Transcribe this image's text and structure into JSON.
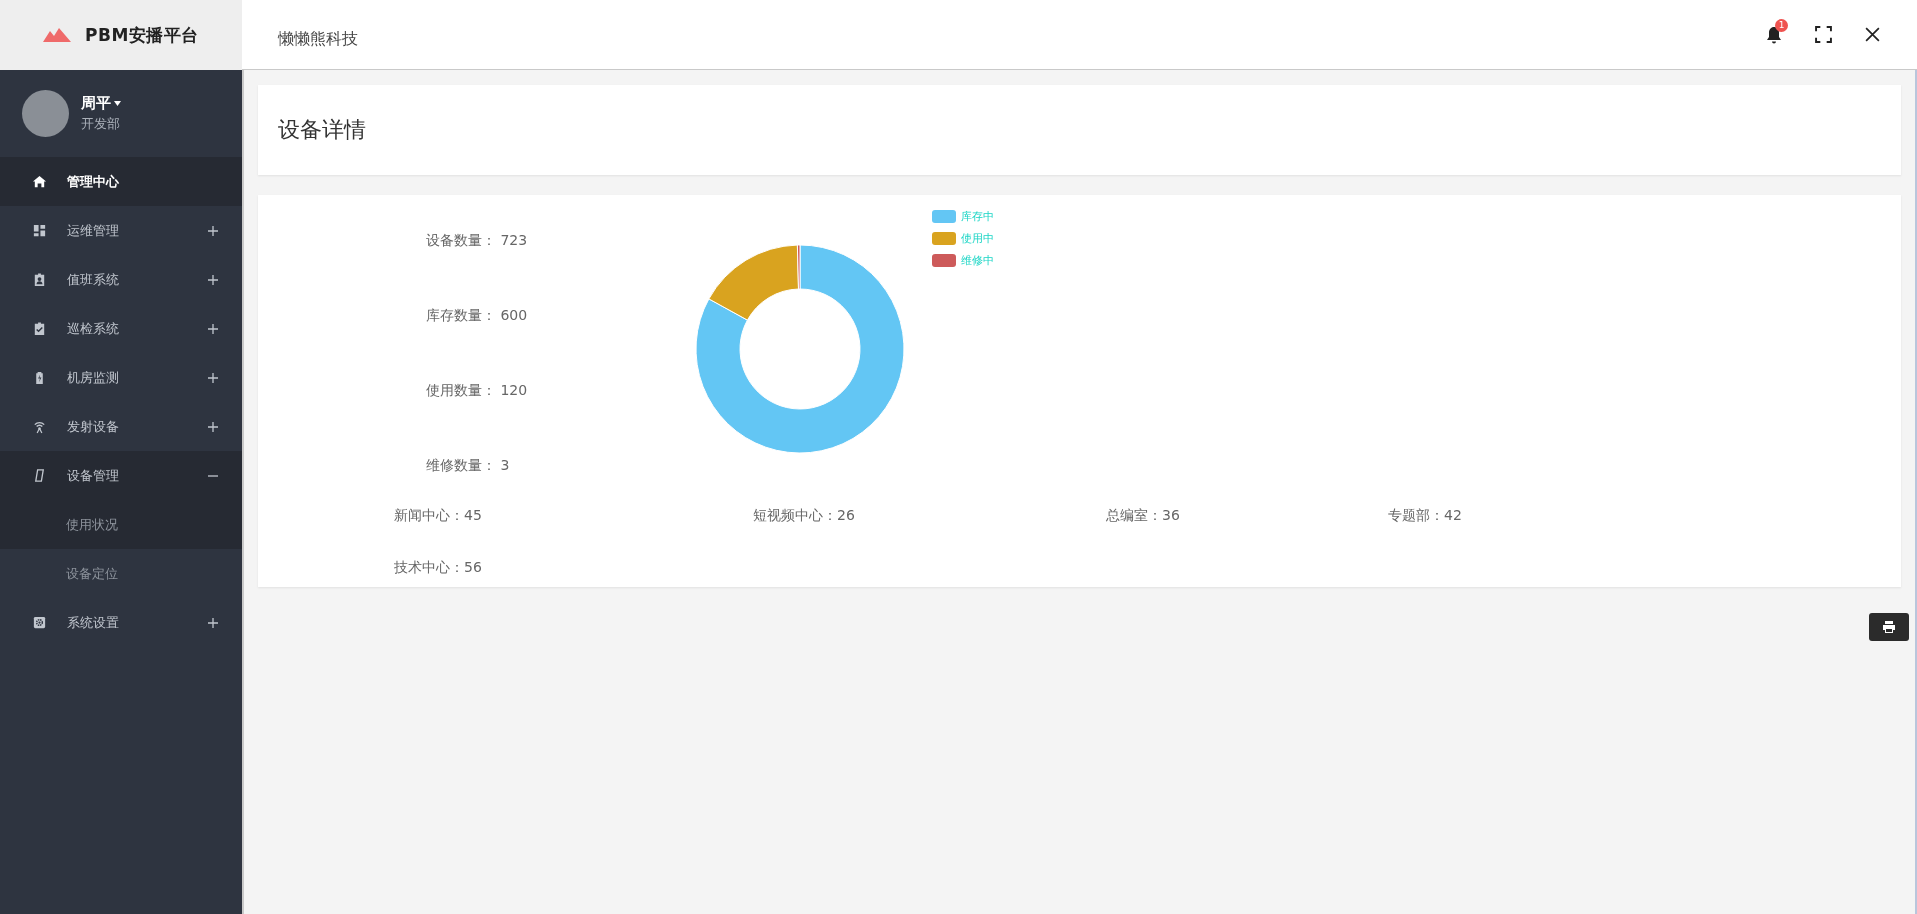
{
  "brand": {
    "name": "PBM安播平台"
  },
  "header": {
    "title": "懒懒熊科技",
    "notification_count": "1"
  },
  "user": {
    "name": "周平",
    "department": "开发部"
  },
  "sidebar": {
    "items": [
      {
        "label": "管理中心",
        "selected": true
      },
      {
        "label": "运维管理",
        "selected": false,
        "expanded": false
      },
      {
        "label": "值班系统",
        "selected": false,
        "expanded": false
      },
      {
        "label": "巡检系统",
        "selected": false,
        "expanded": false
      },
      {
        "label": "机房监测",
        "selected": false,
        "expanded": false
      },
      {
        "label": "发射设备",
        "selected": false,
        "expanded": false
      },
      {
        "label": "设备管理",
        "selected": false,
        "expanded": true,
        "children": [
          {
            "label": "使用状况",
            "selected": false
          },
          {
            "label": "设备定位",
            "selected": false
          }
        ]
      },
      {
        "label": "系统设置",
        "selected": false,
        "expanded": false
      }
    ]
  },
  "page": {
    "title": "设备详情"
  },
  "stats": [
    {
      "label": "设备数量：",
      "value": "723"
    },
    {
      "label": "库存数量：",
      "value": "600"
    },
    {
      "label": "使用数量：",
      "value": "120"
    },
    {
      "label": "维修数量：",
      "value": "3"
    }
  ],
  "chart_data": {
    "type": "donut",
    "categories": [
      "库存中",
      "使用中",
      "维修中"
    ],
    "values": [
      83.0,
      16.6,
      0.4
    ],
    "colors": [
      "#63c6f4",
      "#d9a31f",
      "#cd5a5a"
    ],
    "legend": "top-right"
  },
  "departments": [
    {
      "label": "新闻中心：45"
    },
    {
      "label": "短视频中心：26"
    },
    {
      "label": "总编室：36"
    },
    {
      "label": "专题部：42"
    },
    {
      "label": "技术中心：56"
    }
  ]
}
